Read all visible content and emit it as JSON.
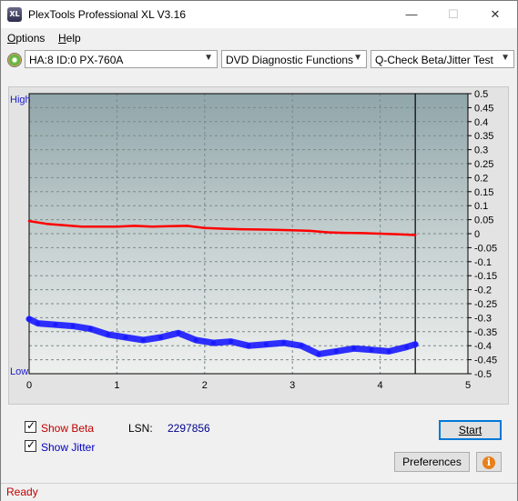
{
  "window": {
    "title": "PlexTools Professional XL V3.16",
    "icon_label": "XL"
  },
  "window_controls": {
    "minimize": "—",
    "maximize": "☐",
    "close": "✕"
  },
  "menu": [
    {
      "label": "Options",
      "underline": "O"
    },
    {
      "label": "Help",
      "underline": "H"
    }
  ],
  "toolbar": {
    "drive": "HA:8 ID:0  PX-760A",
    "function": "DVD Diagnostic Functions",
    "test": "Q-Check Beta/Jitter Test"
  },
  "chart_data": {
    "type": "line",
    "y_label_high": "High",
    "y_label_low": "Low",
    "x_ticks": [
      "0",
      "1",
      "2",
      "3",
      "4",
      "5"
    ],
    "y_ticks": [
      "0.5",
      "0.45",
      "0.4",
      "0.35",
      "0.3",
      "0.25",
      "0.2",
      "0.15",
      "0.1",
      "0.05",
      "0",
      "-0.05",
      "-0.1",
      "-0.15",
      "-0.2",
      "-0.25",
      "-0.3",
      "-0.35",
      "-0.4",
      "-0.45",
      "-0.5"
    ],
    "xlim": [
      0,
      5
    ],
    "ylim": [
      -0.5,
      0.5
    ],
    "end_marker_x": 4.4,
    "grid": true,
    "series": [
      {
        "name": "Beta",
        "color": "#ff0000",
        "x": [
          0,
          0.2,
          0.4,
          0.6,
          0.8,
          1.0,
          1.2,
          1.4,
          1.6,
          1.8,
          2.0,
          2.2,
          2.4,
          2.6,
          2.8,
          3.0,
          3.2,
          3.4,
          3.6,
          3.8,
          4.0,
          4.2,
          4.4
        ],
        "values": [
          0.045,
          0.035,
          0.03,
          0.025,
          0.025,
          0.025,
          0.028,
          0.025,
          0.027,
          0.028,
          0.02,
          0.018,
          0.016,
          0.015,
          0.014,
          0.012,
          0.01,
          0.005,
          0.003,
          0.002,
          0.0,
          -0.002,
          -0.005
        ]
      },
      {
        "name": "Jitter",
        "color": "#1a1aff",
        "x": [
          0,
          0.1,
          0.3,
          0.5,
          0.7,
          0.9,
          1.1,
          1.3,
          1.5,
          1.7,
          1.9,
          2.1,
          2.3,
          2.5,
          2.7,
          2.9,
          3.1,
          3.3,
          3.5,
          3.7,
          3.9,
          4.1,
          4.3,
          4.4
        ],
        "values": [
          -0.305,
          -0.32,
          -0.325,
          -0.33,
          -0.34,
          -0.36,
          -0.37,
          -0.38,
          -0.37,
          -0.355,
          -0.38,
          -0.39,
          -0.385,
          -0.4,
          -0.395,
          -0.39,
          -0.4,
          -0.43,
          -0.42,
          -0.41,
          -0.415,
          -0.42,
          -0.405,
          -0.395
        ]
      }
    ]
  },
  "controls": {
    "show_beta": {
      "label": "Show Beta",
      "checked": true,
      "color": "#c00000"
    },
    "show_jitter": {
      "label": "Show Jitter",
      "checked": true,
      "color": "#0000c0"
    },
    "lsn_label": "LSN:",
    "lsn_value": "2297856",
    "start_label": "Start",
    "preferences_label": "Preferences",
    "info_icon": "info-icon"
  },
  "status": {
    "text": "Ready"
  }
}
